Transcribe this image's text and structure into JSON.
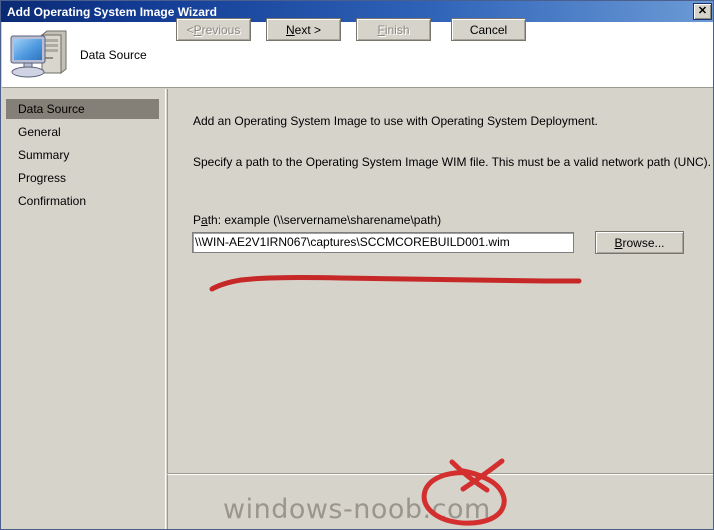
{
  "window": {
    "title": "Add Operating System Image Wizard",
    "close_icon": "close-icon",
    "close_glyph": "✕"
  },
  "header": {
    "title": "Data Source",
    "icon": "computer-icon"
  },
  "sidebar": {
    "items": [
      {
        "label": "Data Source",
        "selected": true
      },
      {
        "label": "General",
        "selected": false
      },
      {
        "label": "Summary",
        "selected": false
      },
      {
        "label": "Progress",
        "selected": false
      },
      {
        "label": "Confirmation",
        "selected": false
      }
    ]
  },
  "main": {
    "paragraph_1": "Add an Operating System Image to use with Operating System Deployment.",
    "paragraph_2": "Specify a path to the Operating System Image WIM file. This must be a valid network path (UNC).",
    "path_label_prefix": "P",
    "path_label_accel": "a",
    "path_label_suffix": "th: example (\\\\servername\\sharename\\path)",
    "path_label_full": "Path: example (\\\\servername\\sharename\\path)",
    "path_value": "\\\\WIN-AE2V1IRN067\\captures\\SCCMCOREBUILD001.wim",
    "path_placeholder": "\\\\servername\\sharename\\path",
    "browse_label_accel": "B",
    "browse_label_rest": "rowse...",
    "browse_label_full": "Browse..."
  },
  "footer": {
    "buttons": [
      {
        "name": "previous",
        "label_prefix": "< ",
        "label_accel": "P",
        "label_rest": "revious",
        "label_full": "< Previous",
        "disabled": true
      },
      {
        "name": "next",
        "label_prefix": "",
        "label_accel": "N",
        "label_rest": "ext >",
        "label_full": "Next >",
        "disabled": false
      },
      {
        "name": "finish",
        "label_prefix": "",
        "label_accel": "F",
        "label_rest": "inish",
        "label_full": "Finish",
        "disabled": true
      },
      {
        "name": "cancel",
        "label_prefix": "",
        "label_accel": "",
        "label_rest": "Cancel",
        "label_full": "Cancel",
        "disabled": false
      }
    ]
  },
  "watermark": {
    "text": "windows-noob.com"
  },
  "annotations": {
    "underline_color": "#c62828",
    "circle_color": "#d32f2f",
    "description_underline": "red hand-drawn underline beneath the path text box",
    "description_circle": "red hand-drawn oval circling the Next button"
  },
  "colors": {
    "titlebar_start": "#0a2a73",
    "titlebar_end": "#6d9bd6",
    "dialog_face": "#d6d3cb",
    "header_bg": "#ffffff",
    "selection": "#848078",
    "disabled_text": "#8c8880"
  }
}
